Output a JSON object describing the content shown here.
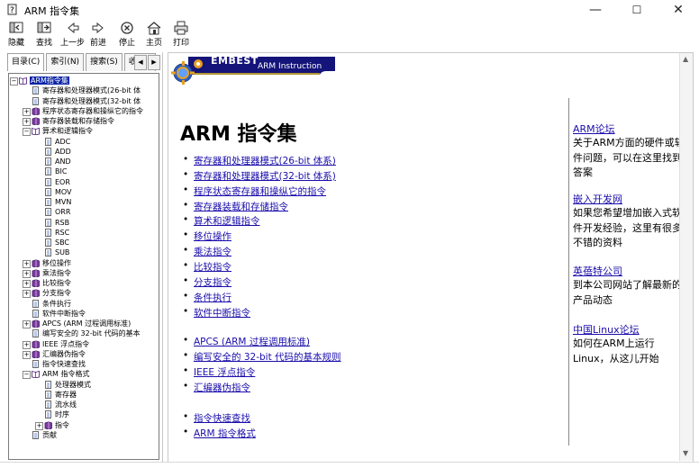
{
  "window": {
    "title": "ARM 指令集",
    "minimize": "—",
    "maximize": "☐",
    "close": "✕"
  },
  "toolbar": [
    {
      "name": "hide-button",
      "label": "隐藏",
      "icon": "hide-icon"
    },
    {
      "name": "locate-button",
      "label": "查找",
      "icon": "locate-icon"
    },
    {
      "name": "back-button",
      "label": "上一步",
      "icon": "back-arrow-icon"
    },
    {
      "name": "forward-button",
      "label": "前进",
      "icon": "forward-arrow-icon"
    },
    {
      "name": "stop-button",
      "label": "停止",
      "icon": "stop-icon"
    },
    {
      "name": "home-button",
      "label": "主页",
      "icon": "home-icon"
    },
    {
      "name": "print-button",
      "label": "打印",
      "icon": "printer-icon"
    }
  ],
  "tabs": [
    "目录(C)",
    "索引(N)",
    "搜索(S)",
    "收"
  ],
  "tree": [
    {
      "label": "ARM指令集",
      "level": 0,
      "type": "book-open",
      "expander": "−",
      "selected": true
    },
    {
      "label": "寄存器和处理器模式(26-bit 体",
      "level": 1,
      "type": "page"
    },
    {
      "label": "寄存器和处理器模式(32-bit 体",
      "level": 1,
      "type": "page"
    },
    {
      "label": "程序状态寄存器和操纵它的指令",
      "level": 1,
      "type": "book",
      "expander": "+"
    },
    {
      "label": "寄存器装载和存储指令",
      "level": 1,
      "type": "book",
      "expander": "+"
    },
    {
      "label": "算术和逻辑指令",
      "level": 1,
      "type": "book-open",
      "expander": "−"
    },
    {
      "label": "ADC",
      "level": 2,
      "type": "page"
    },
    {
      "label": "ADD",
      "level": 2,
      "type": "page"
    },
    {
      "label": "AND",
      "level": 2,
      "type": "page"
    },
    {
      "label": "BIC",
      "level": 2,
      "type": "page"
    },
    {
      "label": "EOR",
      "level": 2,
      "type": "page"
    },
    {
      "label": "MOV",
      "level": 2,
      "type": "page"
    },
    {
      "label": "MVN",
      "level": 2,
      "type": "page"
    },
    {
      "label": "ORR",
      "level": 2,
      "type": "page"
    },
    {
      "label": "RSB",
      "level": 2,
      "type": "page"
    },
    {
      "label": "RSC",
      "level": 2,
      "type": "page"
    },
    {
      "label": "SBC",
      "level": 2,
      "type": "page"
    },
    {
      "label": "SUB",
      "level": 2,
      "type": "page"
    },
    {
      "label": "移位操作",
      "level": 1,
      "type": "book",
      "expander": "+"
    },
    {
      "label": "乘法指令",
      "level": 1,
      "type": "book",
      "expander": "+"
    },
    {
      "label": "比较指令",
      "level": 1,
      "type": "book",
      "expander": "+"
    },
    {
      "label": "分支指令",
      "level": 1,
      "type": "book",
      "expander": "+"
    },
    {
      "label": "条件执行",
      "level": 1,
      "type": "page"
    },
    {
      "label": "软件中断指令",
      "level": 1,
      "type": "page"
    },
    {
      "label": "APCS (ARM 过程调用标准)",
      "level": 1,
      "type": "book",
      "expander": "+"
    },
    {
      "label": "编写安全的 32-bit 代码的基本",
      "level": 1,
      "type": "page"
    },
    {
      "label": "IEEE 浮点指令",
      "level": 1,
      "type": "book",
      "expander": "+"
    },
    {
      "label": "汇编器伪指令",
      "level": 1,
      "type": "book",
      "expander": "+"
    },
    {
      "label": "指令快速查找",
      "level": 1,
      "type": "page"
    },
    {
      "label": "ARM 指令格式",
      "level": 1,
      "type": "book-open",
      "expander": "−"
    },
    {
      "label": "处理器模式",
      "level": 2,
      "type": "page"
    },
    {
      "label": "寄存器",
      "level": 2,
      "type": "page"
    },
    {
      "label": "流水线",
      "level": 2,
      "type": "page"
    },
    {
      "label": "时序",
      "level": 2,
      "type": "page"
    },
    {
      "label": "指令",
      "level": 2,
      "type": "book",
      "expander": "+"
    },
    {
      "label": "贡献",
      "level": 1,
      "type": "page"
    }
  ],
  "banner": {
    "brand": "EMBEST",
    "subtitle": "ARM Instruction"
  },
  "content": {
    "heading": "ARM 指令集",
    "group1": [
      "寄存器和处理器模式(26-bit 体系)",
      "寄存器和处理器模式(32-bit 体系)",
      "程序状态寄存器和操纵它的指令",
      "寄存器装载和存储指令",
      "算术和逻辑指令",
      "移位操作",
      "乘法指令",
      "比较指令",
      "分支指令",
      "条件执行",
      "软件中断指令"
    ],
    "group2": [
      "APCS (ARM 过程调用标准)",
      "编写安全的 32-bit 代码的基本规则",
      "IEEE 浮点指令",
      "汇编器伪指令"
    ],
    "group3": [
      "指令快速查找",
      "ARM 指令格式"
    ]
  },
  "sidebar": [
    {
      "title": "ARM论坛",
      "desc": "关于ARM方面的硬件或软件问题，可以在这里找到答案"
    },
    {
      "title": "嵌入开发网",
      "desc": "如果您希望增加嵌入式软件开发经验，这里有很多不错的资料"
    },
    {
      "title": "英蓓特公司",
      "desc": "到本公司网站了解最新的产品动态"
    },
    {
      "title": "中国Linux论坛",
      "desc": "如何在ARM上运行Linux，从这儿开始"
    }
  ],
  "colors": {
    "banner": "#14147a",
    "link": "#1a0dab",
    "selection": "#0a24a6"
  }
}
